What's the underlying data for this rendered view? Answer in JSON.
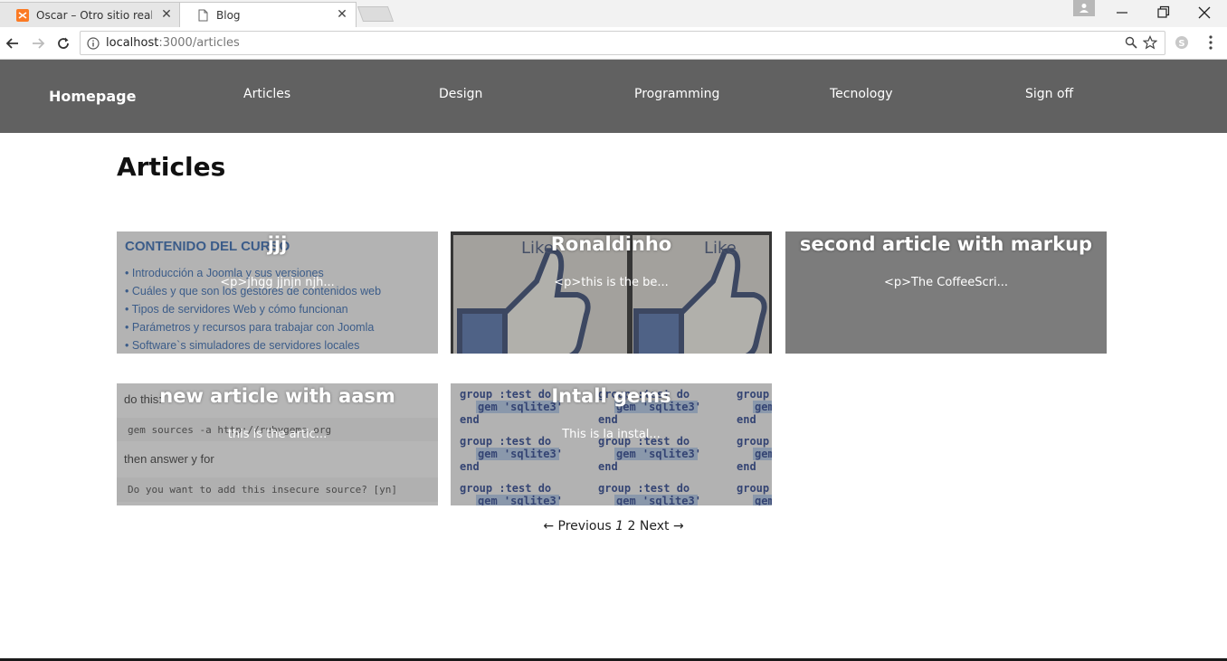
{
  "browser": {
    "tabs": [
      {
        "title": "Oscar – Otro sitio realiza",
        "active": false,
        "icon": "xampp-icon"
      },
      {
        "title": "Blog",
        "active": true,
        "icon": "page-icon"
      }
    ],
    "url_host": "localhost",
    "url_path": ":3000/articles"
  },
  "navbar": {
    "brand": "Homepage",
    "links": [
      "Articles",
      "Design",
      "Programming",
      "Tecnology",
      "Sign off"
    ],
    "background": "#616161"
  },
  "main": {
    "title": "Articles",
    "articles": [
      {
        "title": "jjj",
        "summary": "<p>jhgg jjnjn njh...",
        "image": "course-content"
      },
      {
        "title": "Ronaldinho",
        "summary": "<p>this is the be...",
        "image": "like-thumbs"
      },
      {
        "title": "second article with markup",
        "summary": "<p>The CoffeeScri...",
        "image": "none"
      },
      {
        "title": "new article with aasm",
        "summary": "this is the artic...",
        "image": "gem-sources"
      },
      {
        "title": "Intall gems",
        "summary": "This is la instal...",
        "image": "gem-code"
      }
    ],
    "course_lines": {
      "heading": "CONTENIDO DEL CURSO",
      "items": [
        "• Introducción a Joomla y sus versiones",
        "• Cuáles y que son los gestores de contenidos web",
        "• Tipos de servidores Web y cómo funcionan",
        "• Parámetros y recursos para trabajar con Joomla",
        "• Software`s simuladores de servidores locales"
      ]
    },
    "like_word": "Like",
    "gem_lines": {
      "line1": "do this:",
      "line2": "gem sources -a http://rubygems.org",
      "line3": "then answer y for",
      "line4": "Do you want to add this insecure source? [yn]"
    },
    "code_tile": {
      "group": "group :test do",
      "gem": "gem 'sqlite3'",
      "end": "end"
    }
  },
  "pagination": {
    "prev": "← Previous",
    "current": "1",
    "next_page": "2",
    "next": "Next →"
  }
}
